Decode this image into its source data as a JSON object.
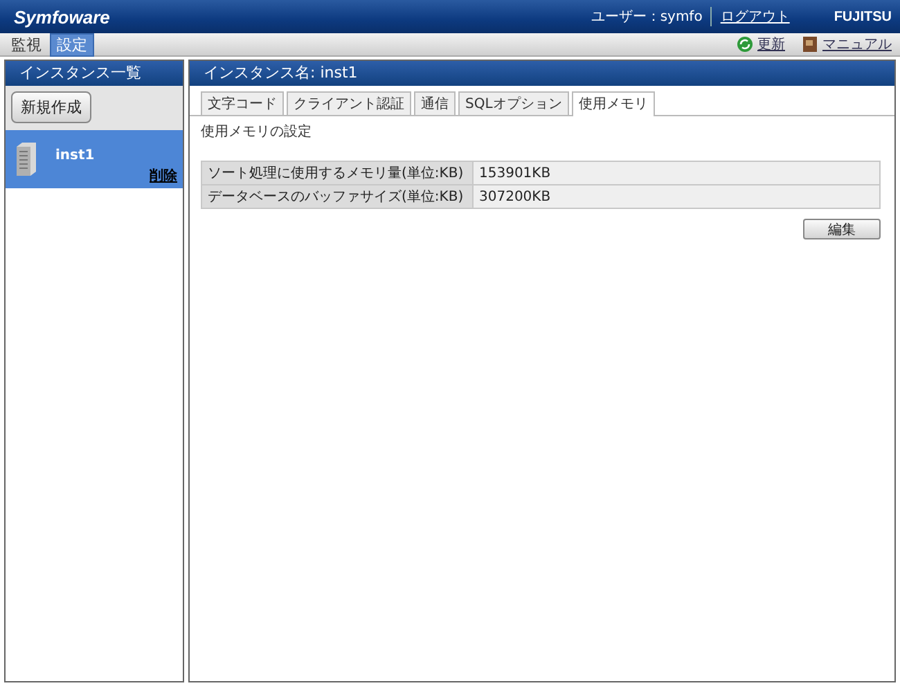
{
  "header": {
    "logo": "Symfoware",
    "user": "ユーザー：symfo",
    "logout": "ログアウト",
    "brand": "FUJITSU"
  },
  "menu": [
    {
      "label": "監視",
      "selected": false
    },
    {
      "label": "設定",
      "selected": true
    }
  ],
  "toolbar": [
    {
      "label": "更新",
      "kind": "refresh"
    },
    {
      "label": "マニュアル",
      "kind": "manual"
    }
  ],
  "sidebar": {
    "title": "インスタンス一覧",
    "new_button": "新規作成",
    "items": [
      {
        "name": "inst1",
        "action": "削除",
        "selected": true
      }
    ]
  },
  "main": {
    "title": "インスタンス名: inst1",
    "tabs": [
      {
        "label": "文字コード",
        "selected": false
      },
      {
        "label": "クライアント認証",
        "selected": false
      },
      {
        "label": "通信",
        "selected": false
      },
      {
        "label": "SQLオプション",
        "selected": false
      },
      {
        "label": "使用メモリ",
        "selected": true
      }
    ],
    "section": "使用メモリの設定",
    "rows": [
      {
        "label": "ソート処理に使用するメモリ量(単位:KB)",
        "value": "153901KB"
      },
      {
        "label": "データベースのバッファサイズ(単位:KB)",
        "value": "307200KB"
      }
    ],
    "edit_button": "編集"
  }
}
